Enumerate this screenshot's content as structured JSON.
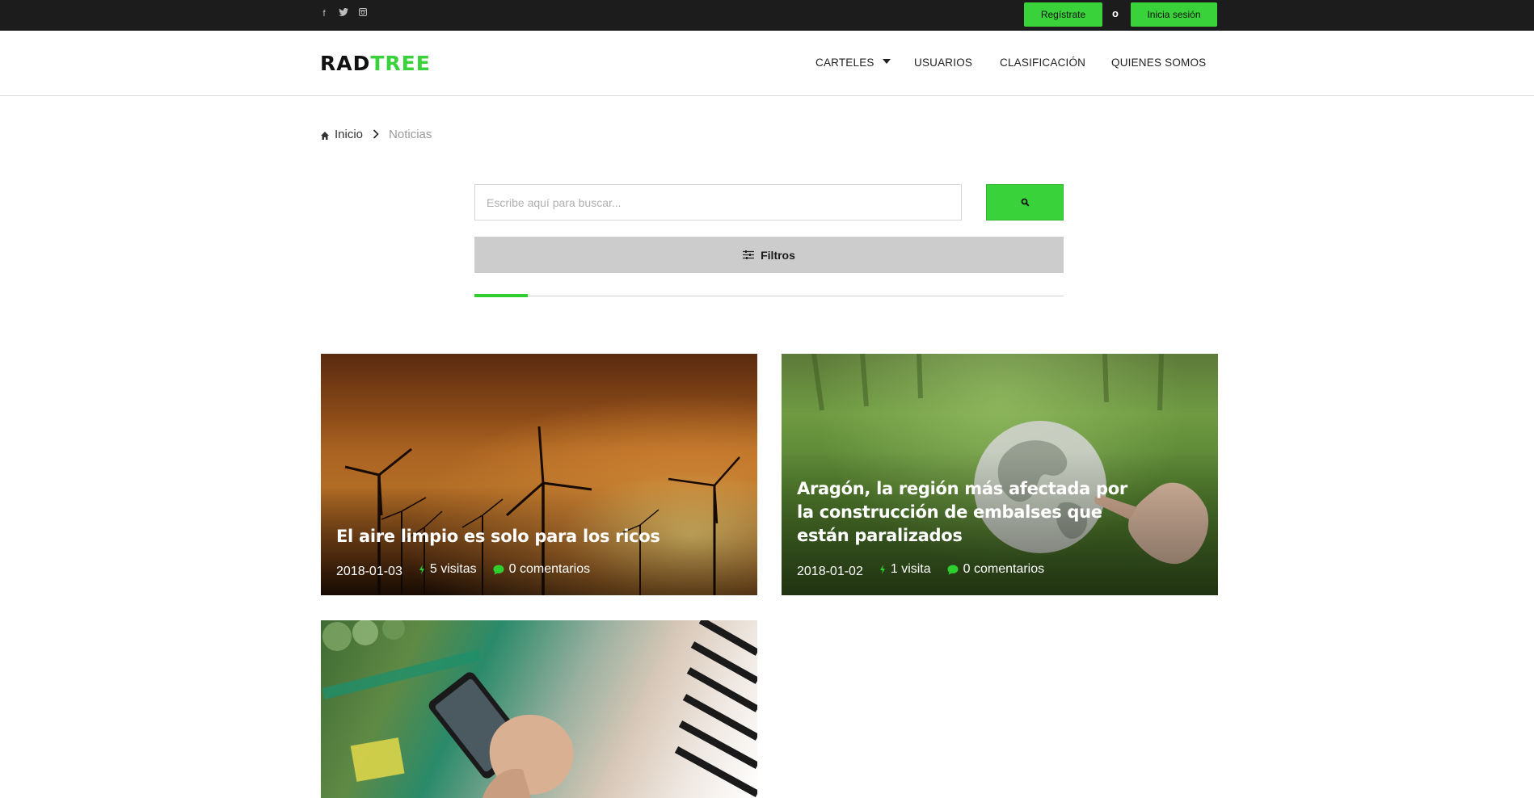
{
  "topbar": {
    "social_icons": [
      "facebook-icon",
      "twitter-icon",
      "instagram-icon"
    ],
    "register_label": "Regístrate",
    "or_label": "o",
    "login_label": "Inicia sesión"
  },
  "header": {
    "logo_part1": "RAD",
    "logo_part2": "TREE",
    "nav": {
      "carteles": "CARTELES",
      "usuarios": "USUARIOS",
      "clasificacion": "CLASIFICACIÓN",
      "quienes": "QUIENES SOMOS"
    }
  },
  "breadcrumb": {
    "home": "Inicio",
    "current": "Noticias"
  },
  "search": {
    "placeholder": "Escribe aquí para buscar...",
    "filters_label": "Filtros",
    "progress_fraction": 0.09
  },
  "cards": [
    {
      "title": "El aire limpio es solo para los ricos",
      "date": "2018-01-03",
      "visits": "5 visitas",
      "comments": "0 comentarios"
    },
    {
      "title": "Aragón, la región más afectada por la construcción de embalses que están paralizados",
      "date": "2018-01-02",
      "visits": "1 visita",
      "comments": "0 comentarios"
    }
  ],
  "colors": {
    "accent": "#3ad23a",
    "topbar": "#1c1c1c"
  }
}
